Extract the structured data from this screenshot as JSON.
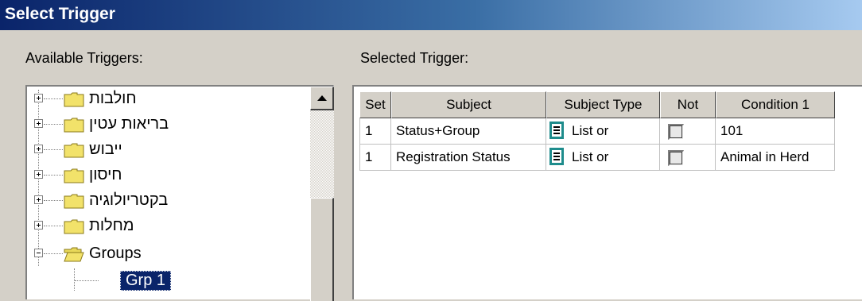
{
  "window": {
    "title": "Select Trigger"
  },
  "available": {
    "label": "Available Triggers:",
    "items": [
      {
        "label": "חולבות",
        "icon": "folder-closed-icon"
      },
      {
        "label": "בריאות עטין",
        "icon": "folder-closed-icon"
      },
      {
        "label": "ייבוש",
        "icon": "folder-closed-icon"
      },
      {
        "label": "חיסון",
        "icon": "folder-closed-icon"
      },
      {
        "label": "בקטריולוגיה",
        "icon": "folder-closed-icon"
      },
      {
        "label": "מחלות",
        "icon": "folder-closed-icon"
      },
      {
        "label": "Groups",
        "icon": "folder-open-icon"
      }
    ],
    "child": {
      "label": "Grp 1",
      "selected": true
    }
  },
  "selected": {
    "label": "Selected Trigger:",
    "columns": [
      "Set",
      "Subject",
      "Subject Type",
      "Not",
      "Condition 1"
    ],
    "rows": [
      {
        "set": "1",
        "subject": "Status+Group",
        "subject_type": "List or",
        "not": false,
        "condition1": "101"
      },
      {
        "set": "1",
        "subject": "Registration Status",
        "subject_type": "List or",
        "not": false,
        "condition1": "Animal in Herd"
      }
    ]
  },
  "colors": {
    "title_start": "#0a246a",
    "title_end": "#a6caf0",
    "selection": "#0a246a",
    "folder": "#f2e26a",
    "list_icon": "#1e8c8c"
  }
}
